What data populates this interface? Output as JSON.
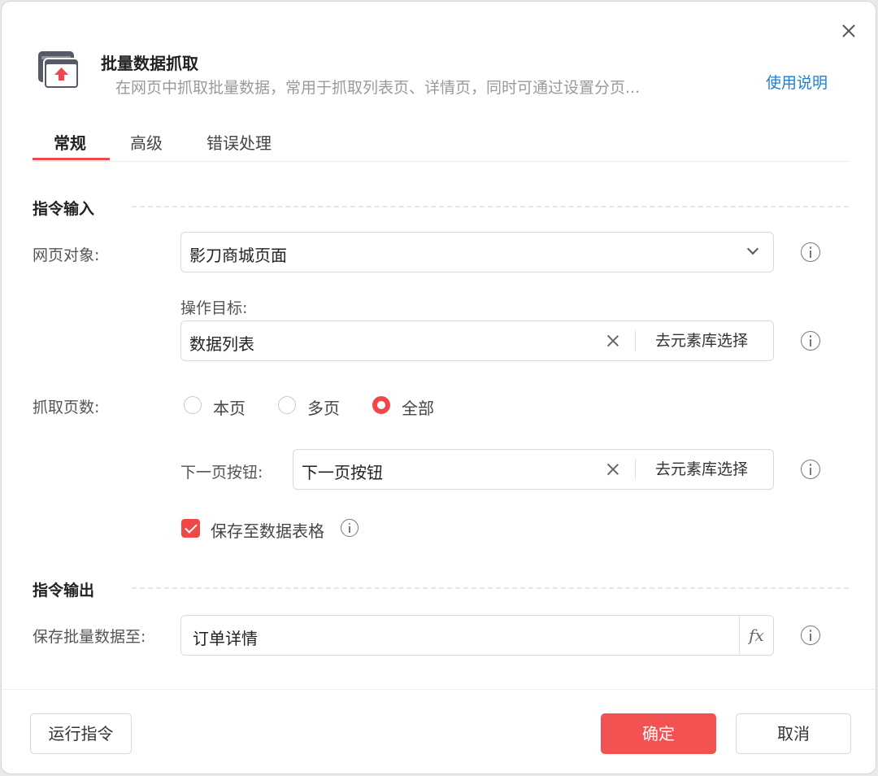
{
  "header": {
    "title": "批量数据抓取",
    "subtitle": "在网页中抓取批量数据，常用于抓取列表页、详情页，同时可通过设置分页...",
    "help_link": "使用说明"
  },
  "tabs": [
    {
      "label": "常规",
      "active": true
    },
    {
      "label": "高级",
      "active": false
    },
    {
      "label": "错误处理",
      "active": false
    }
  ],
  "input_section": {
    "title": "指令输入",
    "web_object": {
      "label": "网页对象:",
      "value": "影刀商城页面"
    },
    "target": {
      "label": "操作目标:",
      "value": "数据列表",
      "pick_label": "去元素库选择"
    },
    "pages": {
      "label": "抓取页数:",
      "options": [
        "本页",
        "多页",
        "全部"
      ],
      "selected": "全部"
    },
    "next_button": {
      "label": "下一页按钮:",
      "value": "下一页按钮",
      "pick_label": "去元素库选择"
    },
    "save_table": {
      "label": "保存至数据表格",
      "checked": true
    }
  },
  "output_section": {
    "title": "指令输出",
    "save_to": {
      "label": "保存批量数据至:",
      "value": "订单详情",
      "fx_label": "fx"
    }
  },
  "footer": {
    "run_label": "运行指令",
    "ok_label": "确定",
    "cancel_label": "取消"
  },
  "colors": {
    "accent": "#f04848",
    "link": "#1e7fd6",
    "icon_bg": "#555a66"
  },
  "icons": [
    "window-upload-icon",
    "close-icon",
    "chevron-down-icon",
    "clear-icon",
    "info-icon",
    "checkmark-icon"
  ]
}
